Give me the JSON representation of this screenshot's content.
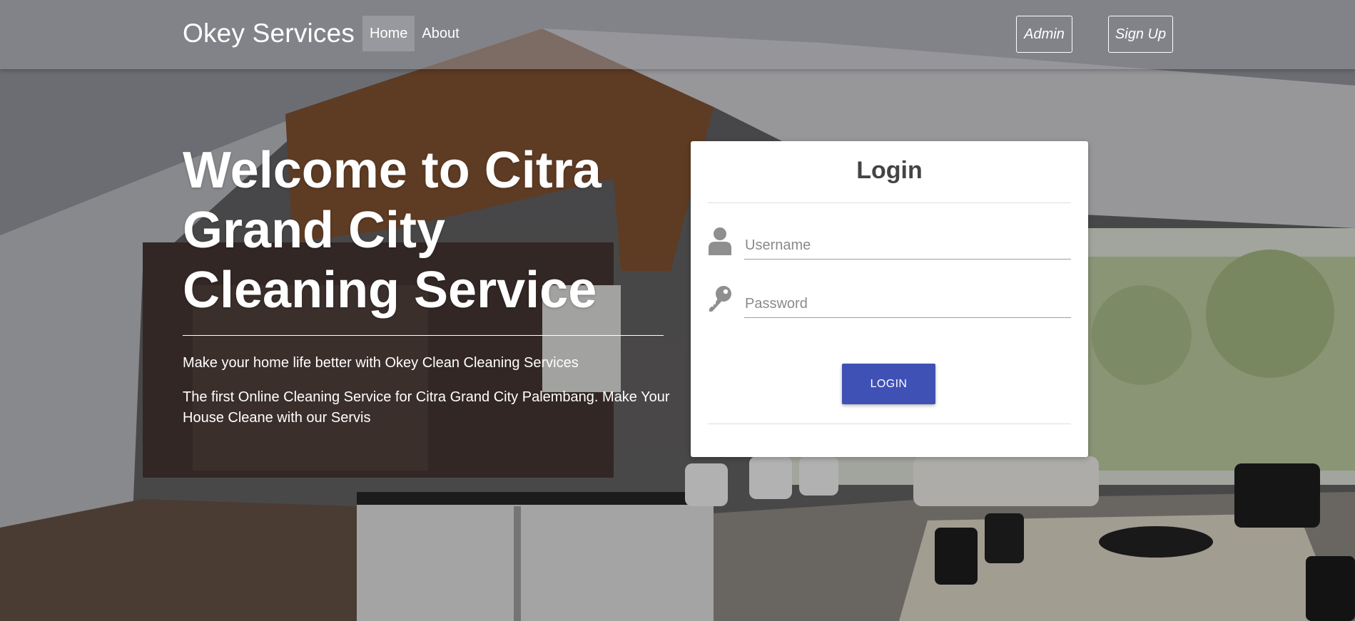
{
  "navbar": {
    "brand": "Okey Services",
    "links": [
      {
        "label": "Home",
        "active": true
      },
      {
        "label": "About",
        "active": false
      }
    ],
    "admin_label": "Admin",
    "signup_label": "Sign Up"
  },
  "hero": {
    "title": "Welcome to Citra Grand City Cleaning Service",
    "subtitle": "Make your home life better with Okey Clean Cleaning Services",
    "description": "The first Online Cleaning Service for Citra Grand City Palembang. Make Your House Cleane with our Servis"
  },
  "login": {
    "title": "Login",
    "username_placeholder": "Username",
    "password_placeholder": "Password",
    "button_label": "LOGIN",
    "username_icon": "user-icon",
    "password_icon": "key-icon"
  },
  "colors": {
    "primary_button": "#3f51b5",
    "text_on_dark": "#ffffff",
    "card_title": "#444444"
  }
}
